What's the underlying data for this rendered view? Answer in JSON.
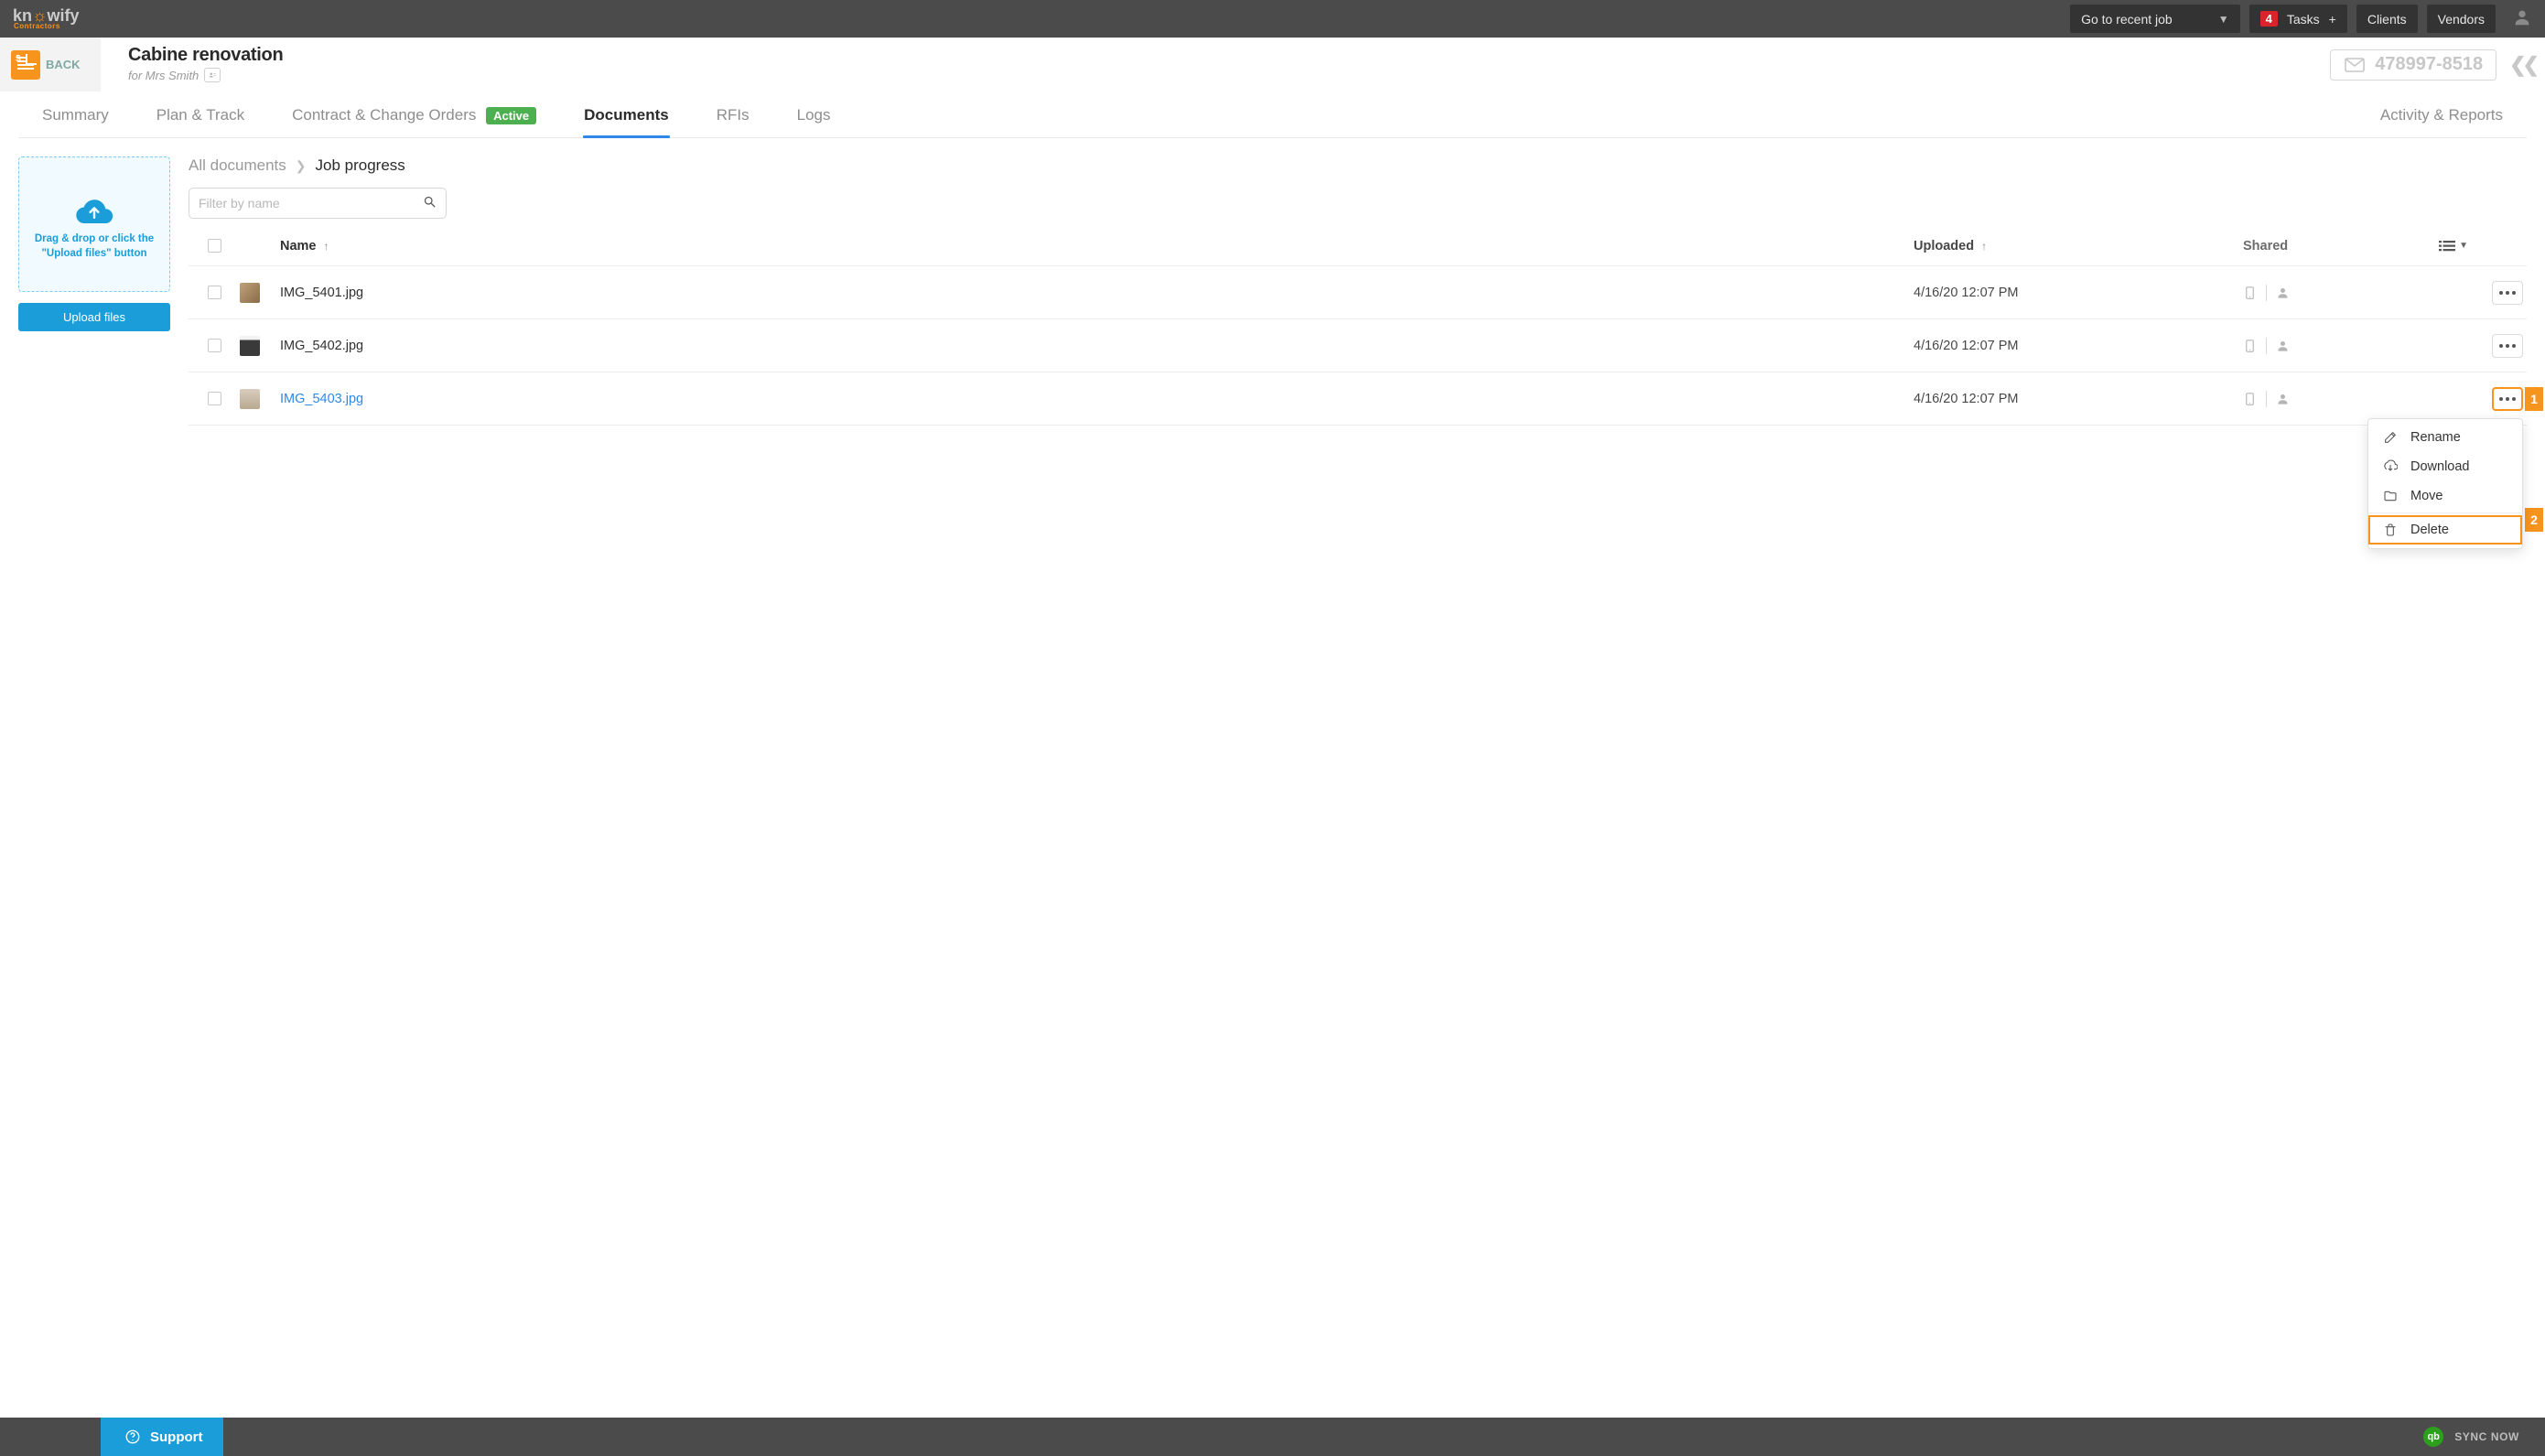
{
  "topbar": {
    "recent_job_label": "Go to recent job",
    "task_count": "4",
    "tasks_label": "Tasks",
    "clients_label": "Clients",
    "vendors_label": "Vendors"
  },
  "header": {
    "back_label": "BACK",
    "job_title": "Cabine renovation",
    "job_for": "for Mrs Smith",
    "job_id": "478997-8518"
  },
  "tabs": {
    "summary": "Summary",
    "plan": "Plan & Track",
    "contract": "Contract & Change Orders",
    "contract_pill": "Active",
    "documents": "Documents",
    "rfis": "RFIs",
    "logs": "Logs",
    "activity": "Activity & Reports"
  },
  "sidebar": {
    "drop_text": "Drag & drop or click the \"Upload files\" button",
    "upload_label": "Upload files"
  },
  "breadcrumb": {
    "root": "All documents",
    "current": "Job progress"
  },
  "filter": {
    "placeholder": "Filter by name"
  },
  "table": {
    "col_name": "Name",
    "col_uploaded": "Uploaded",
    "col_shared": "Shared",
    "rows": [
      {
        "name": "IMG_5401.jpg",
        "uploaded": "4/16/20 12:07 PM"
      },
      {
        "name": "IMG_5402.jpg",
        "uploaded": "4/16/20 12:07 PM"
      },
      {
        "name": "IMG_5403.jpg",
        "uploaded": "4/16/20 12:07 PM"
      }
    ]
  },
  "ctx": {
    "rename": "Rename",
    "download": "Download",
    "move": "Move",
    "delete": "Delete"
  },
  "callouts": {
    "one": "1",
    "two": "2"
  },
  "footer": {
    "support": "Support",
    "sync": "SYNC NOW"
  }
}
